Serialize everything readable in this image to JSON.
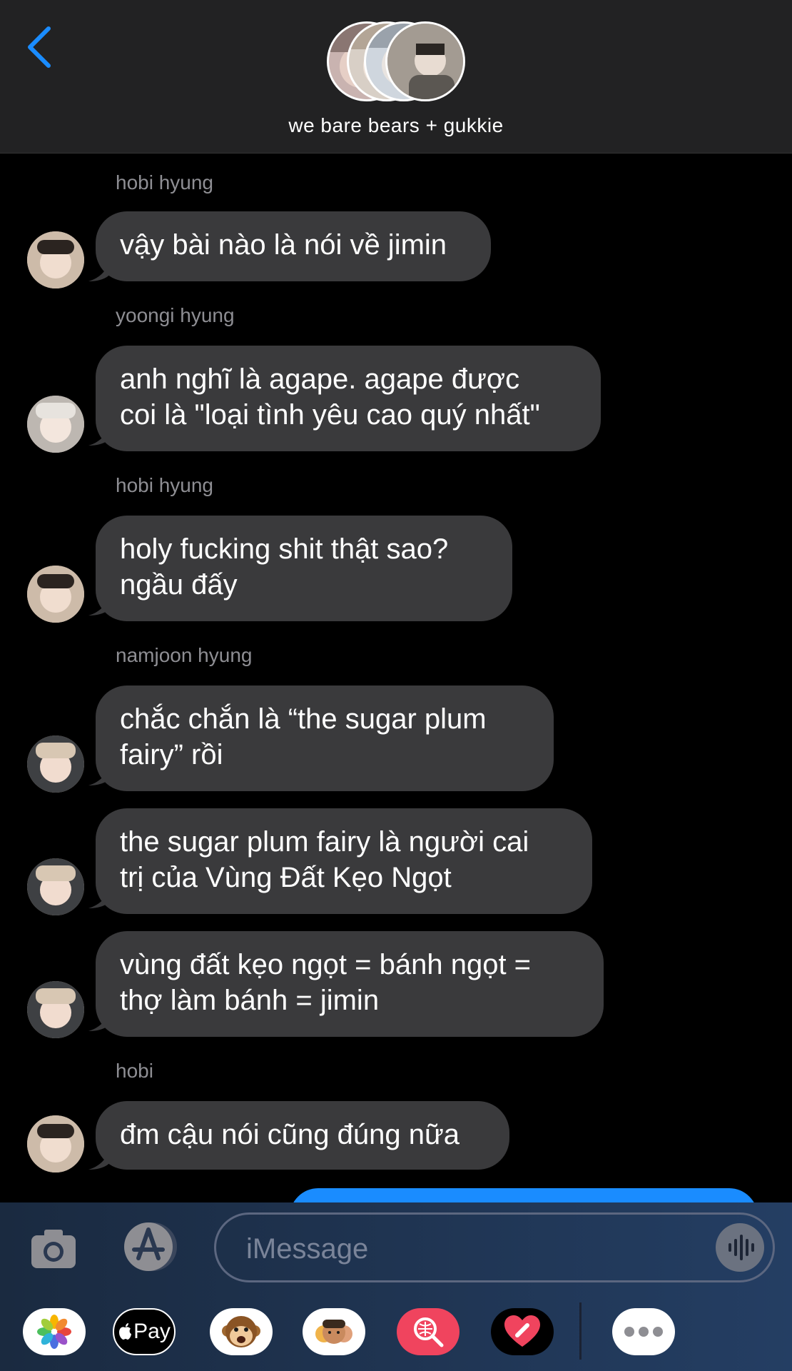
{
  "header": {
    "back_icon": "chevron-left-icon",
    "group_title": "we bare bears + gukkie",
    "accent": "#1a8cff"
  },
  "messages": [
    {
      "sender": "hobi hyung",
      "text": "vậy bài nào là nói về jimin"
    },
    {
      "sender": "yoongi hyung",
      "text": "anh nghĩ là agape. agape được\ncoi là \"loại tình yêu cao quý nhất\""
    },
    {
      "sender": "hobi hyung",
      "text": "holy fucking shit thật sao?\nngầu đấy"
    },
    {
      "sender": "namjoon hyung",
      "text": "chắc chắn là “the sugar plum\nfairy” rồi"
    },
    {
      "sender": "",
      "text": "the sugar plum fairy là người cai\ntrị của Vùng Đất Kẹo Ngọt"
    },
    {
      "sender": "",
      "text": "vùng đất kẹo ngọt = bánh ngọt =\nthợ làm bánh = jimin"
    },
    {
      "sender": "hobi",
      "text": "đm cậu nói cũng đúng nữa"
    }
  ],
  "input": {
    "placeholder": "iMessage",
    "camera_icon": "camera-icon",
    "appstore_icon": "app-store-icon",
    "mic_icon": "audio-waveform-icon"
  },
  "app_tray": [
    {
      "icon": "photos-icon"
    },
    {
      "icon": "apple-pay-icon",
      "label": "Pay"
    },
    {
      "icon": "monkey-animoji-icon"
    },
    {
      "icon": "memoji-icon"
    },
    {
      "icon": "image-search-icon"
    },
    {
      "icon": "digital-touch-heart-icon"
    },
    {
      "icon": "more-icon"
    }
  ]
}
